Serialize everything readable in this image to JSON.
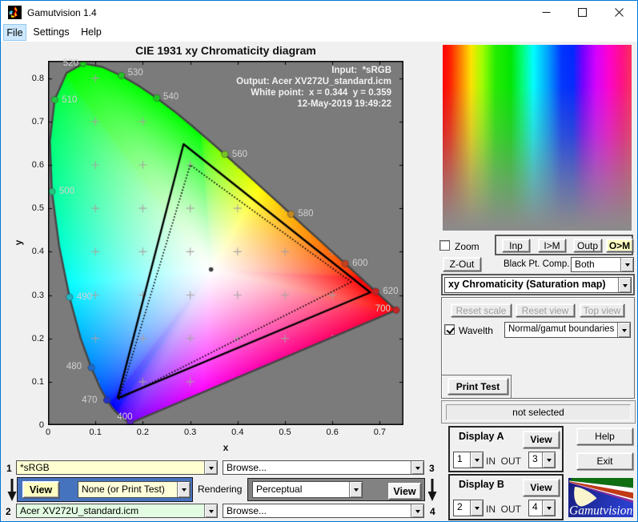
{
  "window": {
    "title": "Gamutvision 1.4"
  },
  "menu": {
    "items": [
      {
        "label": "File"
      },
      {
        "label": "Settings"
      },
      {
        "label": "Help"
      }
    ]
  },
  "chart_data": {
    "type": "scatter",
    "subtype": "CIE-1931-xy-chromaticity-diagram",
    "title": "CIE 1931 xy Chromaticity diagram",
    "xlabel": "x",
    "ylabel": "y",
    "xlim": [
      0,
      0.75
    ],
    "ylim": [
      0,
      0.84
    ],
    "xticks": [
      0,
      0.1,
      0.2,
      0.3,
      0.4,
      0.5,
      0.6,
      0.7
    ],
    "yticks": [
      0,
      0.1,
      0.2,
      0.3,
      0.4,
      0.5,
      0.6,
      0.7,
      0.8
    ],
    "background_color": "#7b7b7b",
    "annotations": [
      "Input:  *sRGB",
      "Output: Acer XV272U_standard.icm",
      "White point:  x = 0.344  y = 0.359",
      "12-May-2019 19:49:22"
    ],
    "white_point": {
      "x": 0.344,
      "y": 0.359
    },
    "grid_crosses": {
      "x": [
        0.1,
        0.2,
        0.3,
        0.4,
        0.5,
        0.6
      ],
      "y": [
        0.1,
        0.2,
        0.3,
        0.4,
        0.5,
        0.6,
        0.7,
        0.8
      ]
    },
    "triangles": [
      {
        "name": "output-gamut-acer-xv272u",
        "style": "solid",
        "points": [
          [
            0.68,
            0.306
          ],
          [
            0.286,
            0.648
          ],
          [
            0.147,
            0.062
          ]
        ]
      },
      {
        "name": "input-gamut-srgb",
        "style": "dotted",
        "points": [
          [
            0.64,
            0.33
          ],
          [
            0.3,
            0.6
          ],
          [
            0.15,
            0.06
          ]
        ]
      }
    ],
    "wavelength_marks": [
      {
        "label": "400",
        "x": 0.1733,
        "y": 0.0048,
        "anchor": "left",
        "dx": 3,
        "dy": -7
      },
      {
        "label": "470",
        "x": 0.1241,
        "y": 0.0578,
        "anchor": "left",
        "dx": -12,
        "dy": 0
      },
      {
        "label": "480",
        "x": 0.0913,
        "y": 0.1327,
        "anchor": "left",
        "dx": -12,
        "dy": -1
      },
      {
        "label": "490",
        "x": 0.0454,
        "y": 0.295,
        "anchor": "right",
        "dx": 9,
        "dy": 0
      },
      {
        "label": "500",
        "x": 0.0082,
        "y": 0.5384,
        "anchor": "right",
        "dx": 9,
        "dy": 0
      },
      {
        "label": "510",
        "x": 0.0139,
        "y": 0.7502,
        "anchor": "right",
        "dx": 9,
        "dy": 0
      },
      {
        "label": "520",
        "x": 0.0743,
        "y": 0.8338,
        "anchor": "left",
        "dx": -6,
        "dy": 0
      },
      {
        "label": "530",
        "x": 0.1547,
        "y": 0.8059,
        "anchor": "right",
        "dx": 8,
        "dy": -3
      },
      {
        "label": "540",
        "x": 0.2296,
        "y": 0.7543,
        "anchor": "right",
        "dx": 8,
        "dy": -1
      },
      {
        "label": "560",
        "x": 0.3731,
        "y": 0.6245,
        "anchor": "right",
        "dx": 9,
        "dy": 0
      },
      {
        "label": "580",
        "x": 0.5125,
        "y": 0.4866,
        "anchor": "right",
        "dx": 9,
        "dy": 0
      },
      {
        "label": "600",
        "x": 0.627,
        "y": 0.3725,
        "anchor": "right",
        "dx": 9,
        "dy": 0
      },
      {
        "label": "620",
        "x": 0.6915,
        "y": 0.3083,
        "anchor": "right",
        "dx": 9,
        "dy": 0
      },
      {
        "label": "700",
        "x": 0.7347,
        "y": 0.2653,
        "anchor": "left",
        "dx": -7,
        "dy": -1
      }
    ],
    "spectral_locus": {
      "start_nm": 380,
      "step_nm": 5,
      "xy": [
        [
          0.1741,
          0.005
        ],
        [
          0.174,
          0.005
        ],
        [
          0.1738,
          0.0049
        ],
        [
          0.1736,
          0.0049
        ],
        [
          0.1733,
          0.0048
        ],
        [
          0.173,
          0.0048
        ],
        [
          0.1726,
          0.0048
        ],
        [
          0.1721,
          0.0048
        ],
        [
          0.1714,
          0.0051
        ],
        [
          0.1703,
          0.0058
        ],
        [
          0.1689,
          0.0069
        ],
        [
          0.1669,
          0.0086
        ],
        [
          0.1644,
          0.0109
        ],
        [
          0.1611,
          0.0138
        ],
        [
          0.1566,
          0.0177
        ],
        [
          0.151,
          0.0227
        ],
        [
          0.144,
          0.0297
        ],
        [
          0.1355,
          0.0399
        ],
        [
          0.1241,
          0.0578
        ],
        [
          0.1096,
          0.0868
        ],
        [
          0.0913,
          0.1327
        ],
        [
          0.0687,
          0.2007
        ],
        [
          0.0454,
          0.295
        ],
        [
          0.0235,
          0.4127
        ],
        [
          0.0082,
          0.5384
        ],
        [
          0.0039,
          0.6548
        ],
        [
          0.0139,
          0.7502
        ],
        [
          0.0389,
          0.812
        ],
        [
          0.0743,
          0.8338
        ],
        [
          0.1142,
          0.8262
        ],
        [
          0.1547,
          0.8059
        ],
        [
          0.1929,
          0.7816
        ],
        [
          0.2296,
          0.7543
        ],
        [
          0.2658,
          0.7243
        ],
        [
          0.3016,
          0.6923
        ],
        [
          0.3373,
          0.6589
        ],
        [
          0.3731,
          0.6245
        ],
        [
          0.4087,
          0.5896
        ],
        [
          0.4441,
          0.5547
        ],
        [
          0.4788,
          0.5202
        ],
        [
          0.5125,
          0.4866
        ],
        [
          0.5448,
          0.4544
        ],
        [
          0.5752,
          0.4242
        ],
        [
          0.6029,
          0.3965
        ],
        [
          0.627,
          0.3725
        ],
        [
          0.6482,
          0.3514
        ],
        [
          0.6658,
          0.334
        ],
        [
          0.6801,
          0.3197
        ],
        [
          0.6915,
          0.3083
        ],
        [
          0.7006,
          0.2993
        ],
        [
          0.7079,
          0.292
        ],
        [
          0.714,
          0.2859
        ],
        [
          0.719,
          0.2809
        ],
        [
          0.723,
          0.277
        ],
        [
          0.726,
          0.274
        ],
        [
          0.7283,
          0.2717
        ],
        [
          0.73,
          0.27
        ],
        [
          0.7311,
          0.2689
        ],
        [
          0.732,
          0.268
        ],
        [
          0.7327,
          0.2673
        ],
        [
          0.7334,
          0.2666
        ],
        [
          0.734,
          0.266
        ],
        [
          0.7344,
          0.2656
        ],
        [
          0.7346,
          0.2654
        ],
        [
          0.7347,
          0.2653
        ]
      ]
    }
  },
  "right_panel": {
    "zoom_label": "Zoom",
    "zoom_checked": false,
    "io_buttons": [
      {
        "label": "Inp",
        "active": false
      },
      {
        "label": "I>M",
        "active": false
      },
      {
        "label": "Outp",
        "active": false
      },
      {
        "label": "O>M",
        "active": true
      }
    ],
    "zout_label": "Z-Out",
    "black_pt_label": "Black Pt. Comp.",
    "black_pt_value": "Both",
    "view_mode_value": "xy Chromaticity (Saturation map)",
    "reset_buttons_enabled": false,
    "reset_scale_label": "Reset scale",
    "reset_view_label": "Reset view",
    "top_view_label": "Top view",
    "wavelth_label": "Wavelth",
    "wavelth_checked": true,
    "boundaries_value": "Normal/gamut boundaries",
    "print_test_label": "Print Test",
    "status_value": "not selected",
    "display_a": {
      "title": "Display A",
      "view_label": "View",
      "in_value": "1",
      "inout_label": "IN  OUT",
      "out_value": "3"
    },
    "display_b": {
      "title": "Display B",
      "view_label": "View",
      "in_value": "2",
      "inout_label": "IN  OUT",
      "out_value": "4"
    },
    "help_label": "Help",
    "exit_label": "Exit",
    "accent_colors": {
      "highlight_yellow": "#ffffc2",
      "panel_blue": "#4673be",
      "panel_gray": "#828282"
    }
  },
  "bottom_bar": {
    "row1_index": "1",
    "row1_profile": "*sRGB",
    "row1_browse": "Browse...",
    "row1_right_index": "3",
    "view1_label": "View",
    "test_pattern_value": "None (or Print Test)",
    "rendering_label": "Rendering",
    "intent_value": "Perceptual",
    "view2_label": "View",
    "row2_index": "2",
    "row2_profile": "Acer XV272U_standard.icm",
    "row2_browse": "Browse...",
    "row2_right_index": "4"
  },
  "logo": {
    "text": "Gamutvision"
  }
}
